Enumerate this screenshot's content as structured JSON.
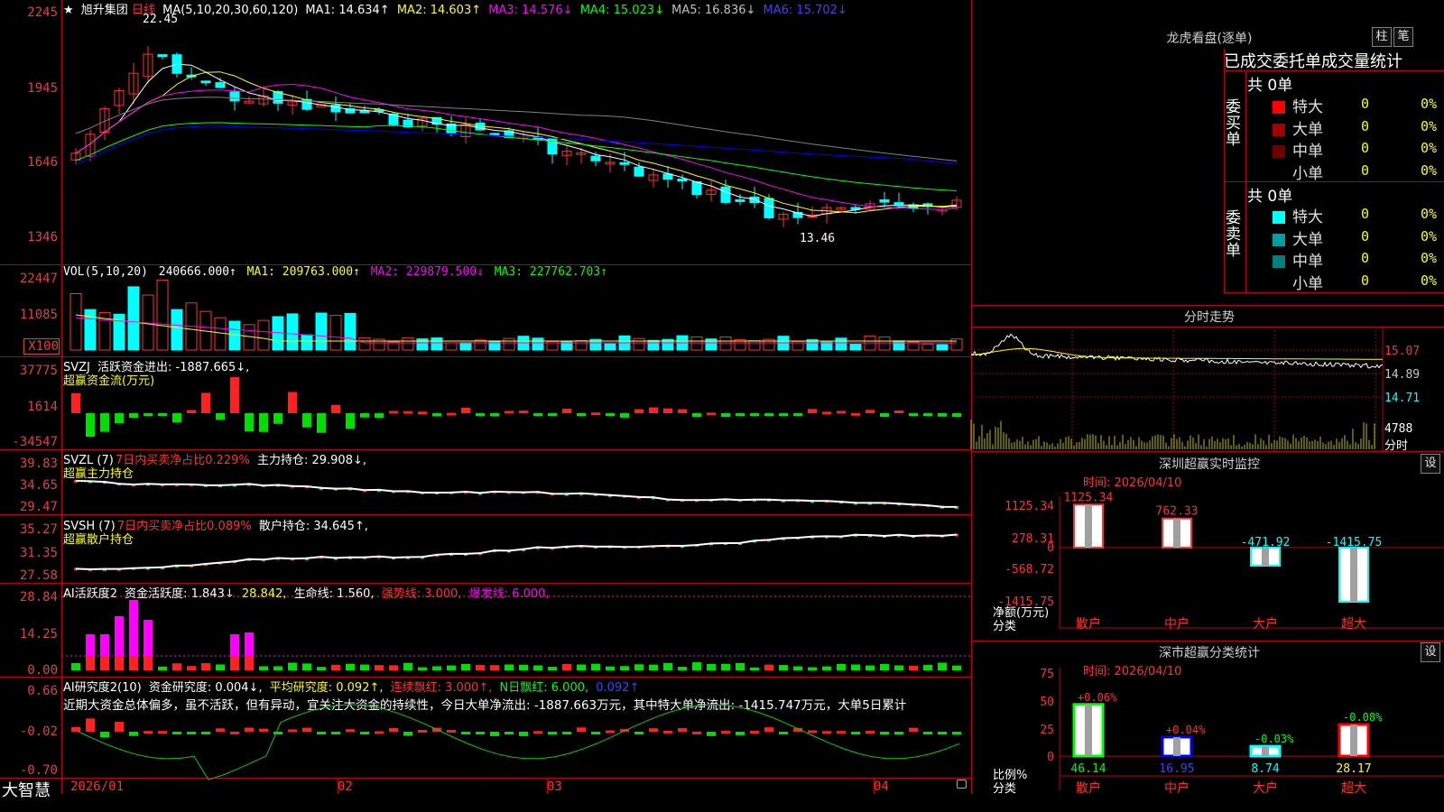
{
  "app": {
    "brand": "大智慧"
  },
  "main_chart": {
    "star": "★",
    "stock_name": "旭升集团",
    "period": "日线",
    "ma_params": "MA(5,10,20,30,60,120)",
    "ma1": "MA1: 14.634↑",
    "ma2": "MA2: 14.603↑",
    "ma3": "MA3: 14.576↓",
    "ma4": "MA4: 15.023↓",
    "ma5": "MA5: 16.836↓",
    "ma6": "MA6: 15.702↓",
    "high_marker": "22.45",
    "low_marker": "13.46",
    "y_ticks": [
      "2245",
      "1945",
      "1646",
      "1346"
    ],
    "colors": {
      "ma1": "#ffffff",
      "ma2": "#ffff00",
      "ma3": "#ff00ff",
      "ma4": "#00ff00",
      "ma5": "#808080",
      "ma6": "#0000ff",
      "up": "#ff3030",
      "down": "#00ffff"
    }
  },
  "volume": {
    "header": "VOL(5,10,20)",
    "value": "240666.000↑",
    "ma1": "MA1: 209763.000↑",
    "ma2": "MA2: 229879.500↓",
    "ma3": "MA3: 227762.703↑",
    "y_ticks": [
      "22447",
      "11085",
      "X100"
    ]
  },
  "svzj": {
    "header": "SVZJ",
    "label": "活跃资金进出: -1887.665↓,",
    "subtitle": "超赢资金流(万元)",
    "y_ticks": [
      "37775",
      "1614",
      "-34547"
    ]
  },
  "svzl": {
    "header": "SVZL (7)",
    "ratio": "7日内买卖净占比0.229%",
    "hold": "主力持仓: 29.908↓,",
    "subtitle": "超赢主力持仓",
    "y_ticks": [
      "39.83",
      "34.65",
      "29.47"
    ]
  },
  "svsh": {
    "header": "SVSH (7)",
    "ratio": "7日内买卖净占比0.089%",
    "hold": "散户持仓: 34.645↑,",
    "subtitle": "超赢散户持仓",
    "y_ticks": [
      "35.27",
      "31.35",
      "27.58"
    ]
  },
  "ai_active": {
    "header": "AI活跃度2",
    "a": "资金活跃度: 1.843↓",
    "b": "28.842,",
    "c": "生命线: 1.560,",
    "d": "强势线: 3.000,",
    "e": "爆发线: 6.000,",
    "y_ticks": [
      "28.84",
      "14.25",
      "0.00"
    ]
  },
  "ai_research": {
    "header": "AI研究度2(10)",
    "a": "资金研究度: 0.004↓,",
    "b": "平均研究度: 0.092↑,",
    "c": "连续飘红: 3.000↑,",
    "d": "N日飘红: 6.000,",
    "e": "0.092↑",
    "comment": "近期大资金总体偏多，虽不活跃，但有异动，宜关注大资金的持续性，今日大单净流出: -1887.663万元，其中特大单净流出: -1415.747万元，大单5日累计",
    "y_ticks": [
      "0.66",
      "-0.02",
      "-0.70"
    ]
  },
  "x_axis": [
    "2026/01",
    "02",
    "03",
    "04"
  ],
  "right_panel": {
    "lhb_title": "龙虎看盘(逐单)",
    "btn_zhu": "柱",
    "btn_bi": "笔",
    "tabs": "已成交委托单成交量统计",
    "buy_total": "共 0单",
    "buy_side": "委买单",
    "sell_total": "共 0单",
    "sell_side": "委卖单",
    "buy_rows": [
      {
        "label": "特大",
        "count": "0",
        "pct": "0%",
        "color": "#ff0000"
      },
      {
        "label": "大单",
        "count": "0",
        "pct": "0%",
        "color": "#a00000"
      },
      {
        "label": "中单",
        "count": "0",
        "pct": "0%",
        "color": "#700000"
      },
      {
        "label": "小单",
        "count": "0",
        "pct": "0%",
        "color": ""
      }
    ],
    "sell_rows": [
      {
        "label": "特大",
        "count": "0",
        "pct": "0%",
        "color": "#00ffff"
      },
      {
        "label": "大单",
        "count": "0",
        "pct": "0%",
        "color": "#00a0a0"
      },
      {
        "label": "中单",
        "count": "0",
        "pct": "0%",
        "color": "#008080"
      },
      {
        "label": "小单",
        "count": "0",
        "pct": "0%",
        "color": ""
      }
    ],
    "minute_title": "分时走势",
    "minute_ticks": [
      "15.07",
      "14.89",
      "14.71",
      "4788",
      "分时"
    ],
    "monitor_title": "深圳超赢实时监控",
    "monitor_btn": "设",
    "monitor_time": "时间: 2026/04/10",
    "monitor_ticks": [
      "1125.34",
      "278.31",
      "0",
      "-568.72",
      "-1415.75"
    ],
    "monitor_ylabel": "净额(万元)",
    "monitor_xlabel": "分类",
    "monitor_bars": [
      {
        "cat": "散户",
        "value": 1125.34,
        "label": "1125.34"
      },
      {
        "cat": "中户",
        "value": 762.33,
        "label": "762.33"
      },
      {
        "cat": "大户",
        "value": -471.92,
        "label": "-471.92"
      },
      {
        "cat": "超大",
        "value": -1415.75,
        "label": "-1415.75"
      }
    ],
    "class_title": "深市超赢分类统计",
    "class_btn": "设",
    "class_time": "时间: 2026/04/10",
    "class_ticks": [
      "75",
      "50",
      "25",
      "0"
    ],
    "class_ylabel": "比例%",
    "class_xlabel": "分类",
    "class_bars": [
      {
        "cat": "散户",
        "value": 46.14,
        "label": "46.14",
        "change": "+0.06%",
        "color": "#00ff00"
      },
      {
        "cat": "中户",
        "value": 16.95,
        "label": "16.95",
        "change": "+0.04%",
        "color": "#0000ff"
      },
      {
        "cat": "大户",
        "value": 8.74,
        "label": "8.74",
        "change": "-0.03%",
        "color": "#00ffff"
      },
      {
        "cat": "超大",
        "value": 28.17,
        "label": "28.17",
        "change": "-0.08%",
        "color": "#ff0000"
      }
    ]
  }
}
